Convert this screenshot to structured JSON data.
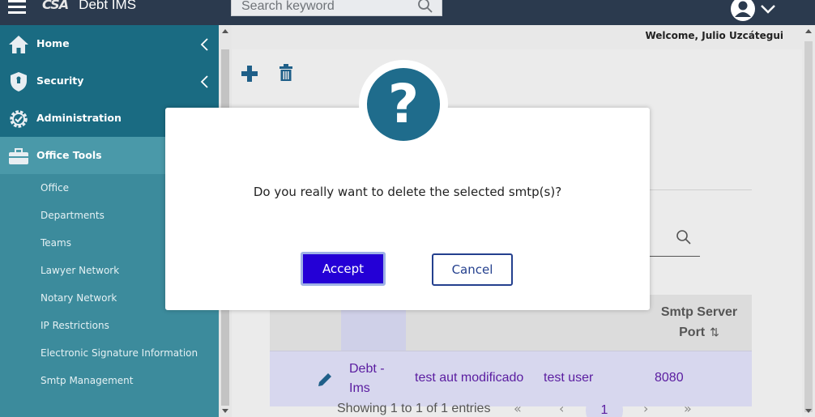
{
  "header": {
    "logo_mark": "CSA",
    "app_name": "Debt IMS",
    "search_placeholder": "Search keyword"
  },
  "welcome_text": "Welcome, Julio Uzcátegui",
  "sidebar": {
    "main_items": [
      {
        "label": "Home",
        "icon": "home-icon"
      },
      {
        "label": "Security",
        "icon": "shield-icon"
      },
      {
        "label": "Administration",
        "icon": "gear-check-icon"
      },
      {
        "label": "Office Tools",
        "icon": "briefcase-icon"
      }
    ],
    "sub_items": [
      "Office",
      "Departments",
      "Teams",
      "Lawyer Network",
      "Notary Network",
      "IP Restrictions",
      "Electronic Signature Information",
      "Smtp Management"
    ]
  },
  "table": {
    "header_port": "Smtp Server Port",
    "sort_glyph": "⇅",
    "row": {
      "name": "Debt - Ims",
      "address": "test aut modificado",
      "username": "test user",
      "port": "8080"
    }
  },
  "pagination": {
    "info": "Showing 1 to 1 of 1 entries",
    "first": "«",
    "prev": "‹",
    "current": "1",
    "next": "›",
    "last": "»"
  },
  "dialog": {
    "icon_glyph": "?",
    "message": "Do you really want to delete the selected smtp(s)?",
    "accept_label": "Accept",
    "cancel_label": "Cancel"
  },
  "colors": {
    "topbar": "#2b3a4e",
    "sidebar": "#3c8b9c",
    "sidebar_top": "#1a6b82",
    "accent_button": "#2400d6",
    "icon_circle": "#1f6c8c",
    "row_highlight": "#d7d7ee"
  }
}
